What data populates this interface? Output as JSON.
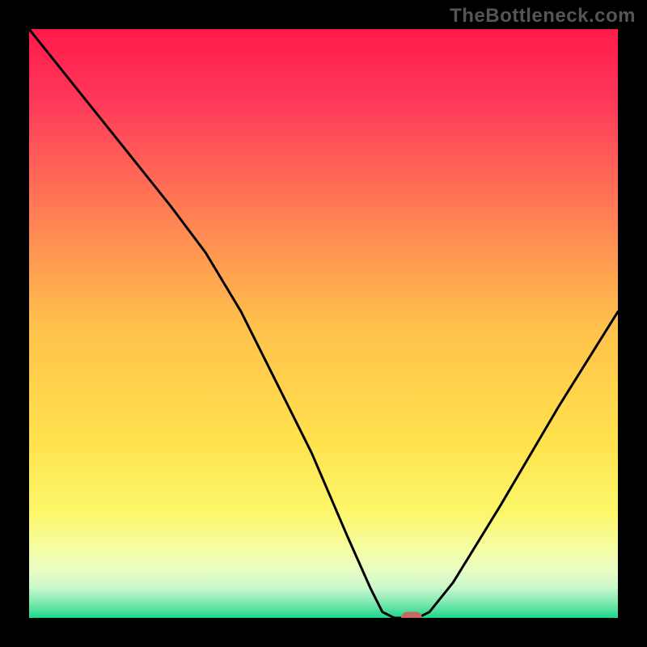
{
  "watermark": "TheBottleneck.com",
  "chart_data": {
    "type": "line",
    "title": "",
    "xlabel": "",
    "ylabel": "",
    "xlim": [
      0,
      100
    ],
    "ylim": [
      0,
      100
    ],
    "series": [
      {
        "name": "bottleneck-curve",
        "x": [
          0,
          8,
          16,
          24,
          30,
          36,
          42,
          48,
          54,
          58,
          60,
          62,
          64,
          66,
          68,
          72,
          80,
          90,
          100
        ],
        "y": [
          100,
          90,
          80,
          70,
          62,
          52,
          40,
          28,
          14,
          5,
          1,
          0,
          0,
          0,
          1,
          6,
          19,
          36,
          52
        ],
        "color": "#000000"
      }
    ],
    "marker": {
      "name": "optimal-point",
      "x": 65,
      "y": 0,
      "color": "#c46a63"
    },
    "background": {
      "gradient_stops": [
        {
          "pos": 0.0,
          "color": "#ff1a4b"
        },
        {
          "pos": 0.12,
          "color": "#ff385a"
        },
        {
          "pos": 0.3,
          "color": "#ff7a54"
        },
        {
          "pos": 0.5,
          "color": "#ffc04c"
        },
        {
          "pos": 0.7,
          "color": "#ffe24d"
        },
        {
          "pos": 0.82,
          "color": "#fcf76a"
        },
        {
          "pos": 0.88,
          "color": "#f6fca0"
        },
        {
          "pos": 0.92,
          "color": "#e8fcc4"
        },
        {
          "pos": 0.95,
          "color": "#c6f8cc"
        },
        {
          "pos": 0.975,
          "color": "#7ce9b0"
        },
        {
          "pos": 1.0,
          "color": "#1ed68a"
        }
      ]
    }
  }
}
